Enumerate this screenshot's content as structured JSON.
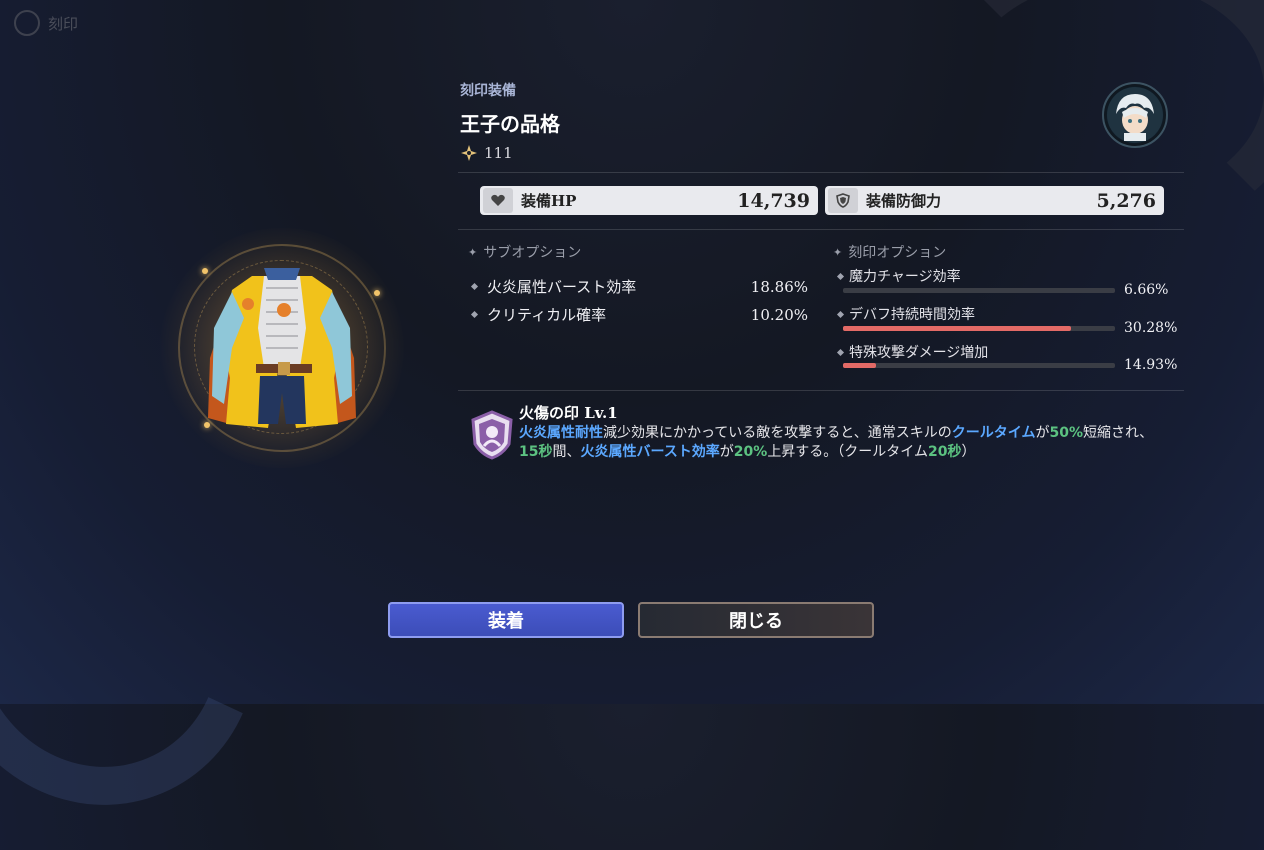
{
  "header": {
    "title": "刻印",
    "right_text": ""
  },
  "item": {
    "category": "刻印装備",
    "name": "王子の品格",
    "power": "111"
  },
  "stats": {
    "hp_label": "装備HP",
    "hp_value": "14,739",
    "def_label": "装備防御力",
    "def_value": "5,276"
  },
  "sub_options": {
    "title": "サブオプション",
    "items": [
      {
        "label": "火炎属性バースト効率",
        "value": "18.86%"
      },
      {
        "label": "クリティカル確率",
        "value": "10.20%"
      }
    ]
  },
  "imprint_options": {
    "title": "刻印オプション",
    "items": [
      {
        "label": "魔力チャージ効率",
        "value": "6.66%",
        "fill": 0
      },
      {
        "label": "デバフ持続時間効率",
        "value": "30.28%",
        "fill": 0.84
      },
      {
        "label": "特殊攻撃ダメージ増加",
        "value": "14.93%",
        "fill": 0.12
      }
    ]
  },
  "skill": {
    "title": "火傷の印 Lv.1",
    "desc_parts": [
      {
        "text": "火炎属性耐性",
        "style": "blue"
      },
      {
        "text": "減少効果にかかっている敵を攻撃すると、通常スキルの",
        "style": "plain"
      },
      {
        "text": "クールタイム",
        "style": "blue"
      },
      {
        "text": "が",
        "style": "plain"
      },
      {
        "text": "50%",
        "style": "green"
      },
      {
        "text": "短縮され、",
        "style": "plain"
      },
      {
        "text": "15秒",
        "style": "green"
      },
      {
        "text": "間、",
        "style": "plain"
      },
      {
        "text": "火炎属性バースト効率",
        "style": "blue"
      },
      {
        "text": "が",
        "style": "plain"
      },
      {
        "text": "20%",
        "style": "green"
      },
      {
        "text": "上昇する。（クールタイム",
        "style": "plain"
      },
      {
        "text": "20秒",
        "style": "green"
      },
      {
        "text": "）",
        "style": "plain"
      }
    ]
  },
  "buttons": {
    "equip_label": "装着",
    "close_label": "閉じる"
  },
  "colors": {
    "accent_blue": "#5ba8ff",
    "accent_green": "#5cc281",
    "bar_fill": "#e36a66",
    "equip_button": "#4252c4"
  }
}
